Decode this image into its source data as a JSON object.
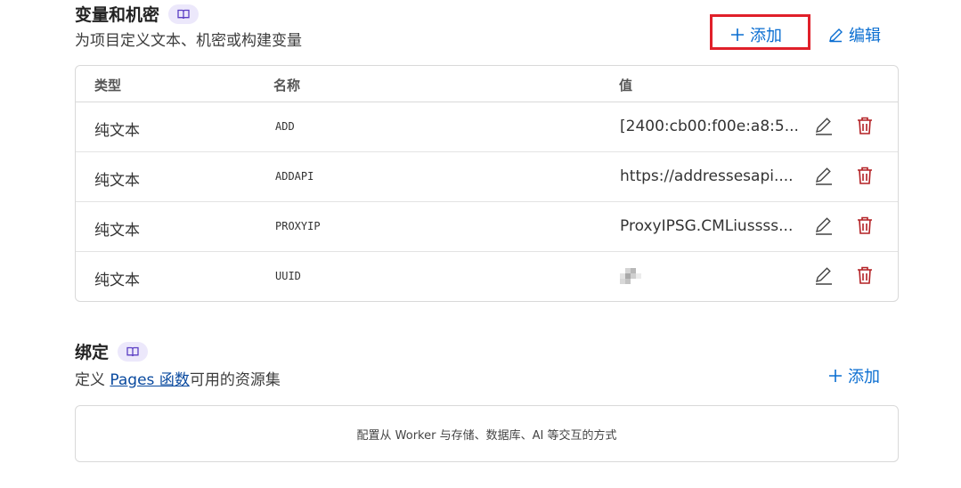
{
  "variables": {
    "title": "变量和机密",
    "subtitle": "为项目定义文本、机密或构建变量",
    "add_label": "添加",
    "edit_label": "编辑",
    "columns": {
      "type": "类型",
      "name": "名称",
      "value": "值"
    },
    "rows": [
      {
        "type": "纯文本",
        "name": "ADD",
        "value": "[2400:cb00:f00e:a8:5..."
      },
      {
        "type": "纯文本",
        "name": "ADDAPI",
        "value": "https://addressesapi...."
      },
      {
        "type": "纯文本",
        "name": "PROXYIP",
        "value": "ProxyIPSG.CMLiussss..."
      },
      {
        "type": "纯文本",
        "name": "UUID",
        "value": ""
      }
    ]
  },
  "bindings": {
    "title": "绑定",
    "subtitle_prefix": "定义 ",
    "subtitle_link": "Pages 函数",
    "subtitle_suffix": "可用的资源集",
    "add_label": "添加",
    "empty_text": "配置从 Worker 与存储、数据库、AI 等交互的方式"
  },
  "colors": {
    "accent": "#0a6ed1",
    "danger": "#b32024",
    "highlight": "#e0202a",
    "badge": "#ece8fb"
  }
}
